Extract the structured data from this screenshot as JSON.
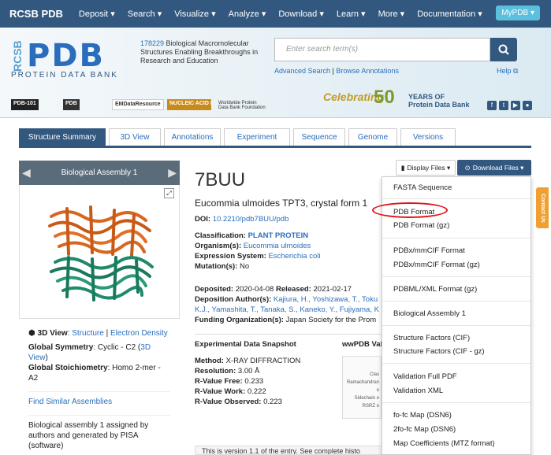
{
  "nav": {
    "brand": "RCSB PDB",
    "items": [
      "Deposit ▾",
      "Search ▾",
      "Visualize ▾",
      "Analyze ▾",
      "Download ▾",
      "Learn ▾",
      "More ▾",
      "Documentation ▾"
    ],
    "mypdb": "MyPDB ▾"
  },
  "banner": {
    "logo_rcsb": "RCSB",
    "logo_pdb": "PDB",
    "logo_sub": "PROTEIN DATA BANK",
    "tagline_count": "178229",
    "tagline_text": " Biological Macromolecular Structures Enabling Breakthroughs in Research and Education",
    "search_placeholder": "Enter search term(s)",
    "advanced_search": "Advanced Search",
    "separator": " | ",
    "browse_annotations": "Browse Annotations",
    "help": "Help",
    "partners": [
      "PDB-101",
      "PDB",
      "EMDataResource",
      "NUCLEIC ACID DATABASE",
      "Worldwide Protein Data Bank Foundation"
    ],
    "celebrating": "Celebrating",
    "years_number": "50",
    "years_text_line1": "YEARS OF",
    "years_text_line2": "Protein Data Bank"
  },
  "tabs": [
    "Structure Summary",
    "3D View",
    "Annotations",
    "Experiment",
    "Sequence",
    "Genome",
    "Versions"
  ],
  "left_panel": {
    "assembly_title": "Biological Assembly 1",
    "view3d_label": "3D View",
    "view3d_structure": "Structure",
    "view3d_sep": " | ",
    "view3d_density": "Electron Density",
    "global_symmetry_label": "Global Symmetry",
    "global_symmetry_value": ": Cyclic - C2 (",
    "global_symmetry_link": "3D View",
    "global_symmetry_end": ")",
    "global_stoich_label": "Global Stoichiometry",
    "global_stoich_value": ": Homo 2-mer - A2",
    "find_similar": "Find Similar Assemblies",
    "assembly_note": "Biological assembly 1 assigned by authors and generated by PISA (software)"
  },
  "entry": {
    "id": "7BUU",
    "title": "Eucommia ulmoides TPT3, crystal form 1",
    "doi_label": "DOI: ",
    "doi_value": "10.2210/pdb7BUU/pdb",
    "classification_label": "Classification: ",
    "classification_value": "PLANT PROTEIN",
    "organism_label": "Organism(s): ",
    "organism_value": "Eucommia ulmoides",
    "expression_label": "Expression System: ",
    "expression_value": "Escherichia coli",
    "mutation_label": "Mutation(s): ",
    "mutation_value": "No",
    "deposited_label": "Deposited: ",
    "deposited_value": "2020-04-08 ",
    "released_label": "Released: ",
    "released_value": "2021-02-17",
    "authors_label": "Deposition Author(s): ",
    "authors_line1": "Kajiura, H., Yoshizawa, T., Toku",
    "authors_line2": "K.J., Yamashita, T., Tanaka, S., Kaneko, Y., Fujiyama, K",
    "funding_label": "Funding Organization(s): ",
    "funding_value": "Japan Society for the Prom"
  },
  "snapshot": {
    "title": "Experimental Data Snapshot",
    "method_label": "Method: ",
    "method_value": "X-RAY DIFFRACTION",
    "resolution_label": "Resolution: ",
    "resolution_value": "3.00 Å",
    "rfree_label": "R-Value Free: ",
    "rfree_value": "0.233",
    "rwork_label": "R-Value Work: ",
    "rwork_value": "0.222",
    "robs_label": "R-Value Observed: ",
    "robs_value": "0.223",
    "wwpdb_title": "wwPDB Val",
    "val_lines": [
      "Clas",
      "Ramachandran o",
      "Sidechain o",
      "RSRZ o"
    ]
  },
  "footer_note": "This is version 1.1 of the entry. See complete histo",
  "buttons": {
    "display_files": "Display Files ▾",
    "download_files": "Download Files ▾"
  },
  "dropdown": {
    "items": [
      "FASTA Sequence",
      "PDB Format",
      "PDB Format (gz)",
      "PDBx/mmCIF Format",
      "PDBx/mmCIF Format (gz)",
      "PDBML/XML Format (gz)",
      "Biological Assembly 1",
      "Structure Factors (CIF)",
      "Structure Factors (CIF - gz)",
      "Validation Full PDF",
      "Validation XML",
      "fo-fc Map (DSN6)",
      "2fo-fc Map (DSN6)",
      "Map Coefficients (MTZ format)"
    ]
  },
  "contact_us": "Contact Us",
  "colors": {
    "nav_bg": "#325880",
    "link": "#2a6ebb",
    "highlight": "#e0151b",
    "helix_orange": "#d9661f",
    "helix_green": "#1f8a6a"
  }
}
